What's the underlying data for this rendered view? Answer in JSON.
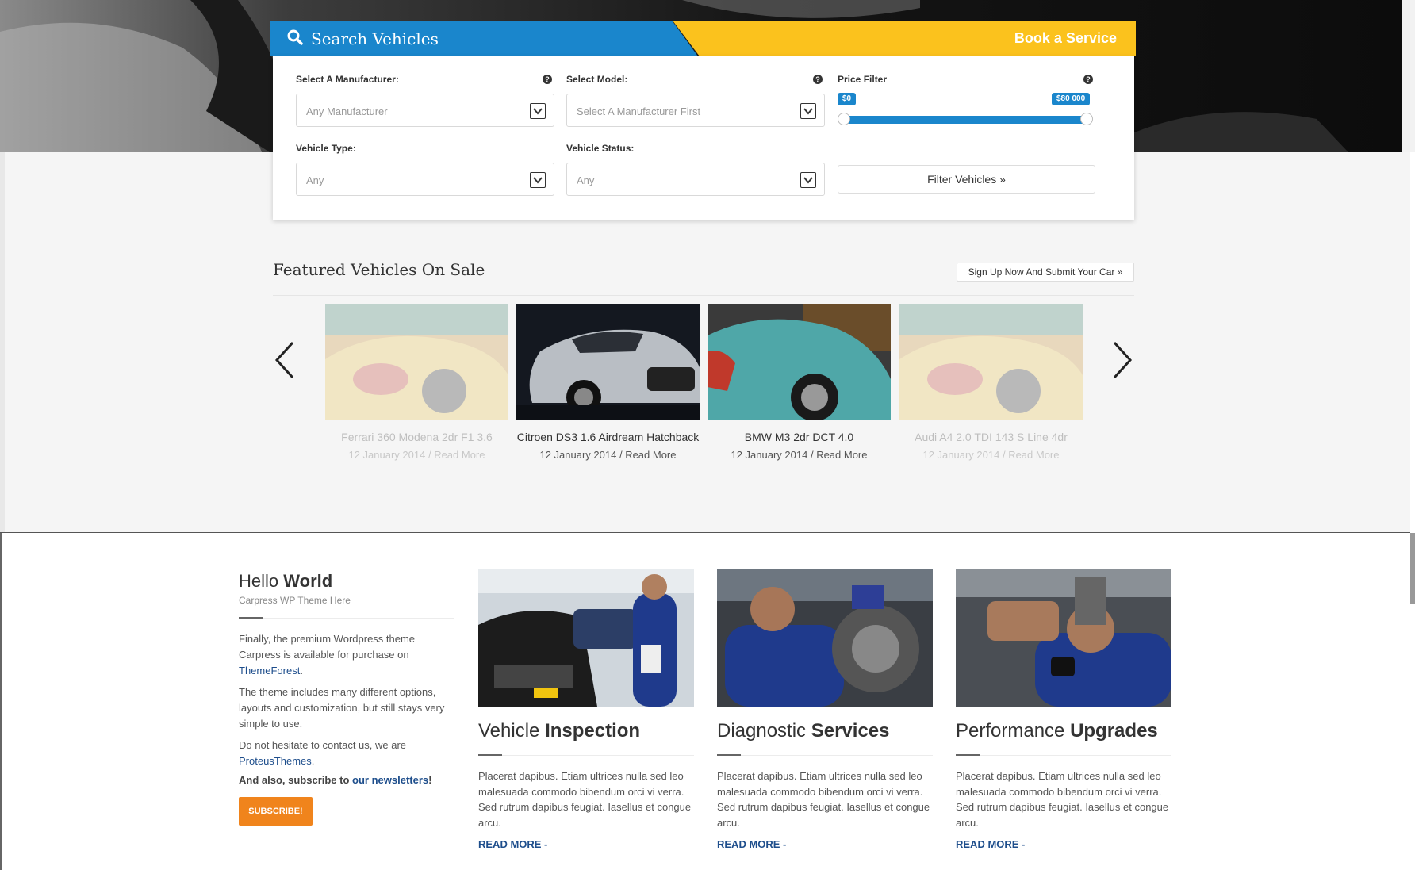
{
  "search": {
    "tab_label": "Search Vehicles",
    "book_label": "Book a Service",
    "manufacturer": {
      "label": "Select A Manufacturer:",
      "value": "Any Manufacturer"
    },
    "model": {
      "label": "Select Model:",
      "value": "Select A Manufacturer First"
    },
    "price": {
      "label": "Price Filter",
      "min_label": "$0",
      "max_label": "$80 000"
    },
    "type": {
      "label": "Vehicle Type:",
      "value": "Any"
    },
    "status": {
      "label": "Vehicle Status:",
      "value": "Any"
    },
    "filter_button": "Filter Vehicles »",
    "help_glyph": "?"
  },
  "featured": {
    "title": "Featured Vehicles On Sale",
    "signup_button": "Sign Up Now And Submit Your Car »",
    "cars": [
      {
        "name": "Ferrari 360 Modena 2dr F1 3.6",
        "date": "12 January 2014",
        "read_more": "Read More",
        "faded": true
      },
      {
        "name": "Citroen DS3 1.6 Airdream Hatchback",
        "date": "12 January 2014",
        "read_more": "Read More",
        "faded": false
      },
      {
        "name": "BMW M3 2dr DCT 4.0",
        "date": "12 January 2014",
        "read_more": "Read More",
        "faded": false
      },
      {
        "name": "Audi A4 2.0 TDI 143 S Line 4dr",
        "date": "12 January 2014",
        "read_more": "Read More",
        "faded": true
      }
    ]
  },
  "intro": {
    "title_light": "Hello",
    "title_bold": "World",
    "subtitle": "Carpress WP Theme Here",
    "p1_text": "Finally, the premium Wordpress theme Carpress is available for purchase on",
    "p1_link": "ThemeForest",
    "p2": "The theme includes many different options, layouts and customization, but still stays very simple to use.",
    "p3_text": "Do not hesitate to contact us, we are",
    "p3_link": "ProteusThemes",
    "subscribe_text": "And also, subscribe to",
    "subscribe_link": "our newsletters",
    "subscribe_button": "SUBSCRIBE!"
  },
  "services": [
    {
      "title_light": "Vehicle",
      "title_bold": "Inspection",
      "text": "Placerat dapibus. Etiam ultrices nulla sed leo malesuada commodo bibendum orci vi verra. Sed rutrum dapibus feugiat. Iasellus et congue arcu.",
      "more": "READ MORE -"
    },
    {
      "title_light": "Diagnostic",
      "title_bold": "Services",
      "text": "Placerat dapibus. Etiam ultrices nulla sed leo malesuada commodo bibendum orci vi verra. Sed rutrum dapibus feugiat. Iasellus et congue arcu.",
      "more": "READ MORE -"
    },
    {
      "title_light": "Performance",
      "title_bold": "Upgrades",
      "text": "Placerat dapibus. Etiam ultrices nulla sed leo malesuada commodo bibendum orci vi verra. Sed rutrum dapibus feugiat. Iasellus et congue arcu.",
      "more": "READ MORE -"
    }
  ],
  "colors": {
    "primary": "#1a86cc",
    "accent": "#fbc21d",
    "subscribe": "#f0841c",
    "link": "#1e4e8c"
  },
  "icons": {
    "search": "search-icon",
    "prev": "chevron-left-icon",
    "next": "chevron-right-icon",
    "select": "chevron-down-icon"
  }
}
